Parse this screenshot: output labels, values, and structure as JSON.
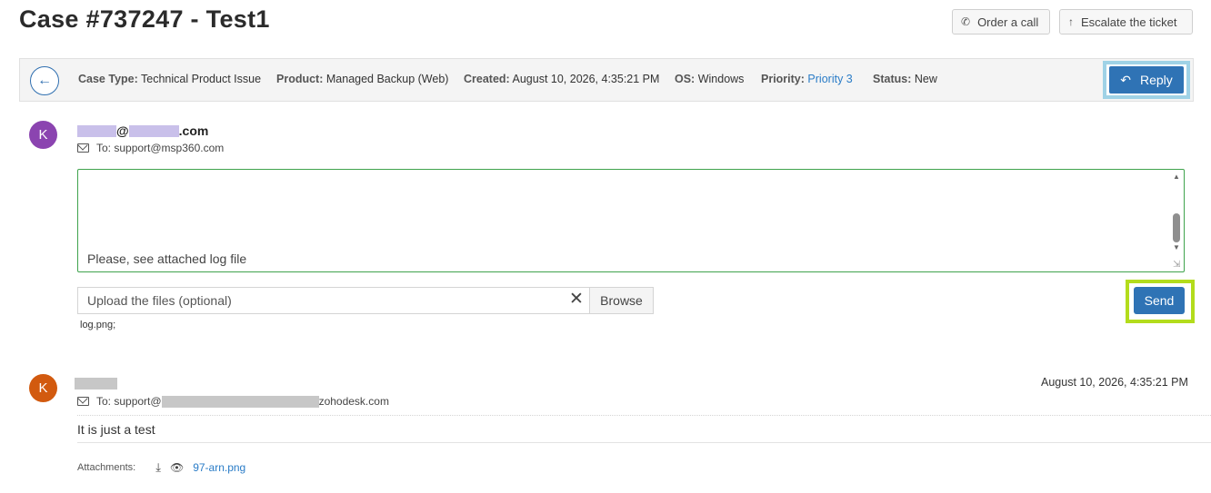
{
  "header": {
    "title": "Case #737247 - Test1",
    "order_call_label": "Order a call",
    "escalate_label": "Escalate the ticket"
  },
  "info_bar": {
    "case_type_label": "Case Type:",
    "case_type_value": "Technical Product Issue",
    "product_label": "Product:",
    "product_value": "Managed Backup (Web)",
    "created_label": "Created:",
    "created_value": "August 10, 2026, 4:35:21 PM",
    "os_label": "OS:",
    "os_value": "Windows",
    "priority_label": "Priority:",
    "priority_value": "Priority 3",
    "status_label": "Status:",
    "status_value": "New",
    "reply_label": "Reply"
  },
  "reply_form": {
    "avatar_letter": "K",
    "sender_at": "@",
    "sender_domain_suffix": ".com",
    "to_line": "To: support@msp360.com",
    "message_text": "Please, see attached log file",
    "upload_placeholder": "Upload the files (optional)",
    "clear_symbol": "✕",
    "browse_label": "Browse",
    "attached_files": "log.png;",
    "send_label": "Send"
  },
  "message": {
    "avatar_letter": "K",
    "to_prefix": "To: support@",
    "to_suffix": "zohodesk.com",
    "date": "August 10, 2026, 4:35:21 PM",
    "body": "It is just a test",
    "attachments_label": "Attachments:",
    "attachment_file": "97-arn.png"
  },
  "colors": {
    "accent_blue": "#2f73b5",
    "avatar_purple": "#8b44b0",
    "avatar_orange": "#d25a0f",
    "reply_highlight": "#9fd2e6",
    "send_highlight": "#b3dc1c",
    "editor_border": "#3fa34d"
  }
}
